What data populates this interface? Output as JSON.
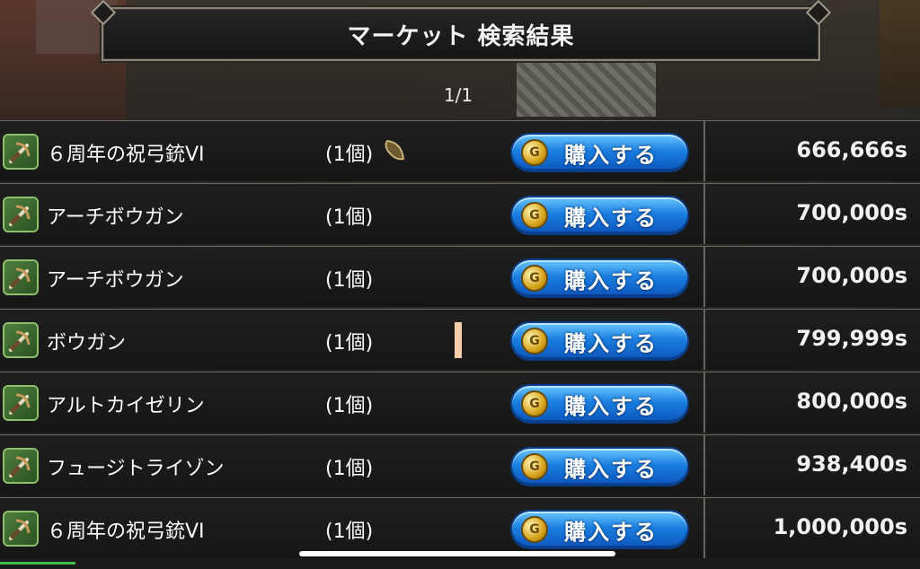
{
  "header": {
    "title": "マーケット 検索結果"
  },
  "pager": {
    "text": "1/1"
  },
  "buy_label": "購入する",
  "rows": [
    {
      "name": "６周年の祝弓銃VI",
      "qty": "(1個)",
      "price": "666,666s",
      "extra": "seed-icon"
    },
    {
      "name": "アーチボウガン",
      "qty": "(1個)",
      "price": "700,000s"
    },
    {
      "name": "アーチボウガン",
      "qty": "(1個)",
      "price": "700,000s"
    },
    {
      "name": "ボウガン",
      "qty": "(1個)",
      "price": "799,999s",
      "extra": "marker"
    },
    {
      "name": "アルトカイゼリン",
      "qty": "(1個)",
      "price": "800,000s"
    },
    {
      "name": "フュージトライゾン",
      "qty": "(1個)",
      "price": "938,400s"
    },
    {
      "name": "６周年の祝弓銃VI",
      "qty": "(1個)",
      "price": "1,000,000s"
    }
  ],
  "colors": {
    "buy_button": "#1a7fe0",
    "icon_frame": "#8dbf6c",
    "progress": "#3fbf4a"
  },
  "icons": {
    "item": "crossbow-icon",
    "coin": "coin-icon",
    "seed": "seed-icon"
  }
}
